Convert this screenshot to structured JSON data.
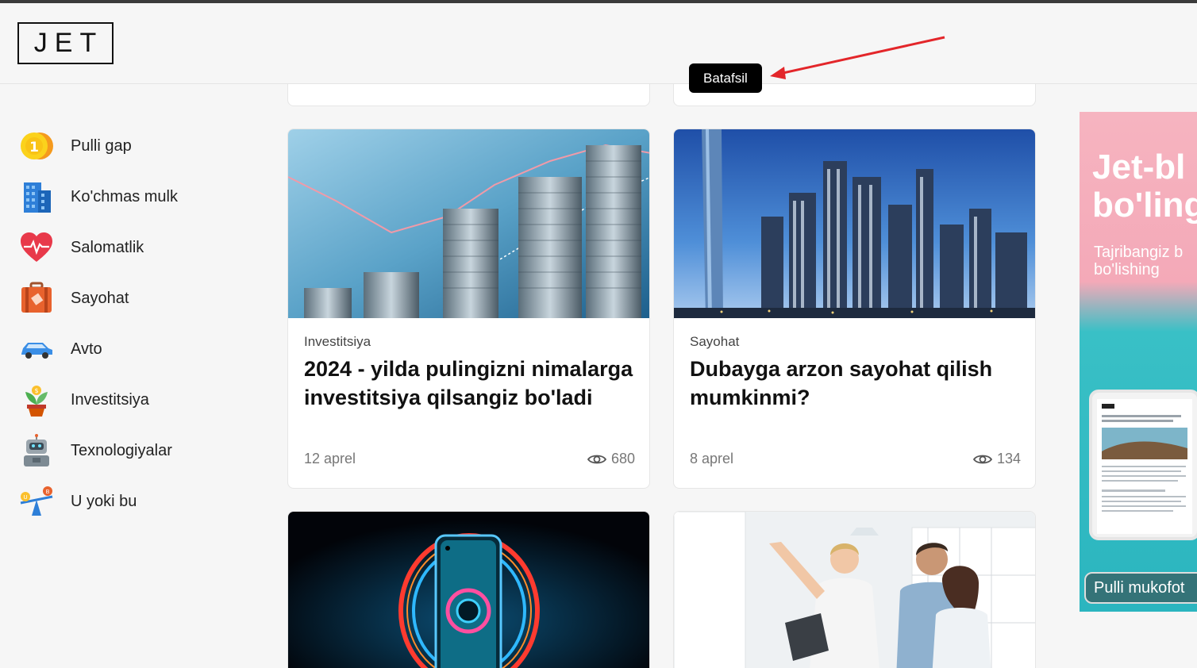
{
  "header": {
    "logo": "JET"
  },
  "tooltip": {
    "label": "Batafsil"
  },
  "sidebar": {
    "items": [
      {
        "label": "Pulli gap",
        "icon": "coin-icon"
      },
      {
        "label": "Ko'chmas mulk",
        "icon": "building-icon"
      },
      {
        "label": "Salomatlik",
        "icon": "heart-pulse-icon"
      },
      {
        "label": "Sayohat",
        "icon": "suitcase-icon"
      },
      {
        "label": "Avto",
        "icon": "car-icon"
      },
      {
        "label": "Investitsiya",
        "icon": "money-plant-icon"
      },
      {
        "label": "Texnologiyalar",
        "icon": "robot-icon"
      },
      {
        "label": "U yoki bu",
        "icon": "seesaw-icon"
      }
    ]
  },
  "articles": [
    {
      "category": "Investitsiya",
      "title": "2024 - yilda pulingizni nimalarga investitsiya qilsangiz bo'ladi",
      "date": "12 aprel",
      "views": "680",
      "image": "coins-stacks-image"
    },
    {
      "category": "Sayohat",
      "title": "Dubayga arzon sayohat qilish mumkinmi?",
      "date": "8 aprel",
      "views": "134",
      "image": "dubai-skyline-image"
    },
    {
      "image": "smartphone-neon-image"
    },
    {
      "image": "real-estate-agent-image"
    }
  ],
  "ad": {
    "headline": "Jet-bloger bo'ling",
    "headline_visible_1": "Jet-bl",
    "headline_visible_2": "bo'ling",
    "subtitle_1": "Tajribangiz b",
    "subtitle_2": "bo'lishing",
    "button": "Pulli mukofot"
  },
  "colors": {
    "accent_arrow": "#e3262a",
    "tooltip_bg": "#000000",
    "ad_pink": "#f4a9b8",
    "ad_teal": "#2bb5bf"
  }
}
